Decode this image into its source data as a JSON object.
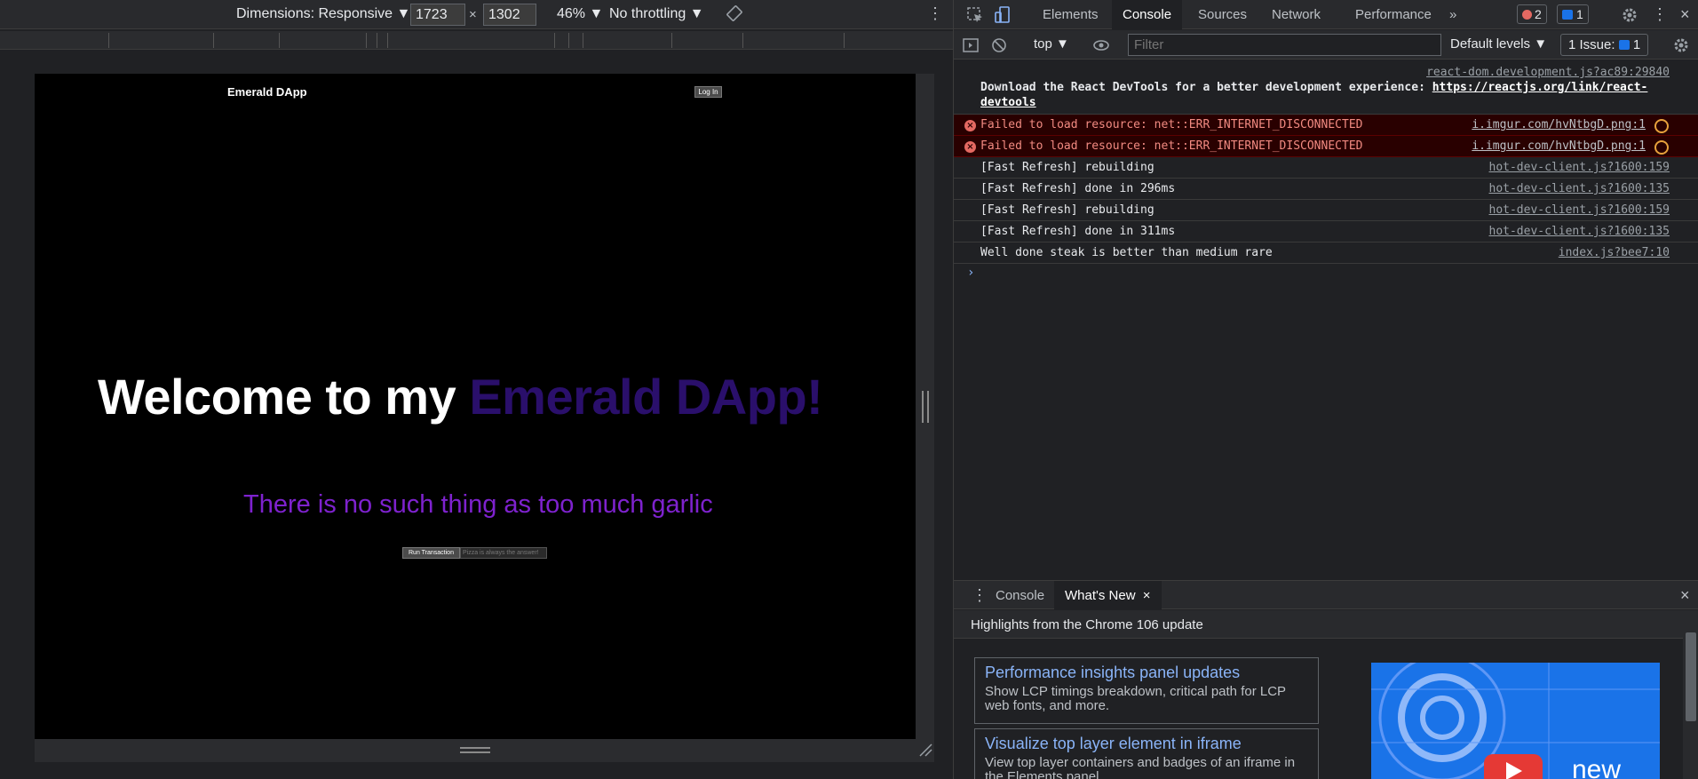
{
  "device_toolbar": {
    "dimensions_label": "Dimensions: Responsive ▼",
    "width_value": "1723",
    "times_symbol": "×",
    "height_value": "1302",
    "zoom": "46% ▼",
    "throttling": "No throttling ▼"
  },
  "dapp": {
    "brand": "Emerald DApp",
    "login_label": "Log In",
    "hero_prefix": "Welcome to my ",
    "hero_accent": "Emerald DApp!",
    "quote": "There is no such thing as too much garlic",
    "run_button": "Run Transaction",
    "input_placeholder": "Pizza is always the answer!"
  },
  "devtools": {
    "tabs": [
      "Elements",
      "Console",
      "Sources",
      "Network",
      "Performance"
    ],
    "more_tabs": "»",
    "error_count": "2",
    "message_count": "1",
    "context": "top ▼",
    "filter_placeholder": "Filter",
    "levels": "Default levels ▼",
    "issues_label": "1 Issue:",
    "issues_count": "1"
  },
  "console": {
    "devtools_note": {
      "source": "react-dom.development.js?ac89:29840",
      "text": "Download the React DevTools for a better development experience: ",
      "link": "https://reactjs.org/link/react-devtools"
    },
    "errors": [
      {
        "text": "Failed to load resource: net::ERR_INTERNET_DISCONNECTED",
        "source": "i.imgur.com/hvNtbgD.png:1"
      },
      {
        "text": "Failed to load resource: net::ERR_INTERNET_DISCONNECTED",
        "source": "i.imgur.com/hvNtbgD.png:1"
      }
    ],
    "logs": [
      {
        "text": "[Fast Refresh] rebuilding",
        "source": "hot-dev-client.js?1600:159"
      },
      {
        "text": "[Fast Refresh] done in 296ms",
        "source": "hot-dev-client.js?1600:135"
      },
      {
        "text": "[Fast Refresh] rebuilding",
        "source": "hot-dev-client.js?1600:159"
      },
      {
        "text": "[Fast Refresh] done in 311ms",
        "source": "hot-dev-client.js?1600:135"
      },
      {
        "text": "Well done steak is better than medium rare",
        "source": "index.js?bee7:10"
      }
    ],
    "prompt": "›"
  },
  "drawer": {
    "tabs": [
      "Console",
      "What's New"
    ],
    "close_tab": "×",
    "close_drawer": "×",
    "header": "Highlights from the Chrome 106 update",
    "cards": [
      {
        "title": "Performance insights panel updates",
        "desc": "Show LCP timings breakdown, critical path for LCP web fonts, and more."
      },
      {
        "title": "Visualize top layer element in iframe",
        "desc": "View top layer containers and badges of an iframe in the Elements panel."
      }
    ],
    "image_text": "new"
  },
  "colors": {
    "accent_purple": "#2a0f6b",
    "quote_purple": "#7e22ce",
    "error_red": "#e46962",
    "link_blue": "#8ab4f8"
  }
}
